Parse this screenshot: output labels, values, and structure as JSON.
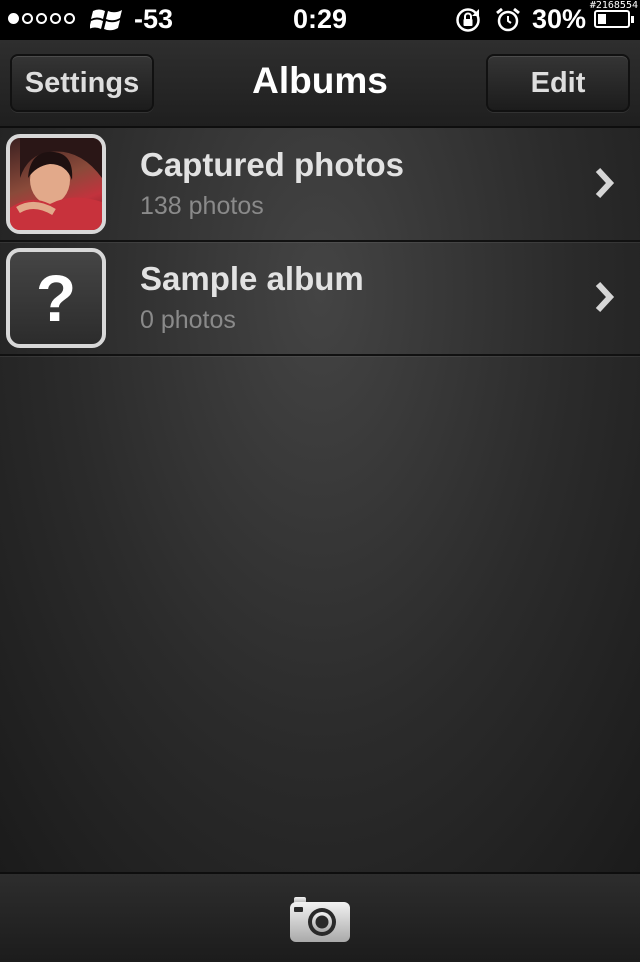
{
  "status_bar": {
    "signal_dots": [
      true,
      false,
      false,
      false,
      false
    ],
    "carrier_icon": "windows-logo-icon",
    "signal_strength": "-53",
    "time": "0:29",
    "rotation_lock_icon": "rotation-lock-icon",
    "alarm_icon": "alarm-clock-icon",
    "battery_percent": "30%",
    "battery_level": 0.3,
    "overlay_id": "#2168554"
  },
  "nav": {
    "left_button": "Settings",
    "title": "Albums",
    "right_button": "Edit"
  },
  "albums": [
    {
      "title": "Captured photos",
      "subtitle": "138 photos",
      "thumbnail": "photo-thumbnail"
    },
    {
      "title": "Sample album",
      "subtitle": "0 photos",
      "thumbnail": "?"
    }
  ],
  "toolbar": {
    "camera_icon": "camera-icon"
  },
  "colors": {
    "background": "#1d1d1d",
    "title_text": "#ffffff",
    "subtitle_text": "#8a8a8a"
  }
}
